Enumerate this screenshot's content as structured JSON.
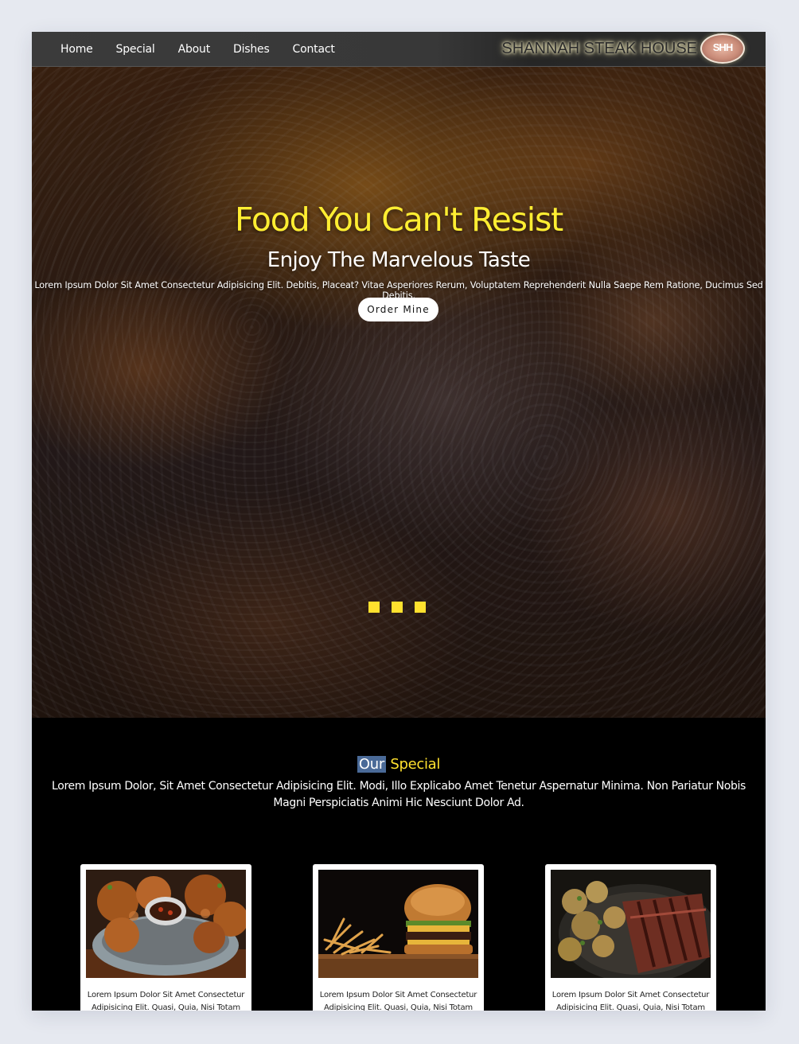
{
  "nav": {
    "links": [
      "Home",
      "Special",
      "About",
      "Dishes",
      "Contact"
    ],
    "brand": "SHANNAH STEAK HOUSE",
    "brand_logo": "SHH"
  },
  "hero": {
    "title": "Food You Can't Resist",
    "subtitle": "Enjoy The Marvelous Taste",
    "description": "Lorem Ipsum Dolor Sit Amet Consectetur Adipisicing Elit. Debitis, Placeat? Vitae Asperiores Rerum, Voluptatem Reprehenderit Nulla Saepe Rem Ratione, Ducimus Sed Debitis.",
    "button": "Order Mine",
    "slide_count": 3
  },
  "special": {
    "title_word1": "Our",
    "title_word2": "Special",
    "description": "Lorem Ipsum Dolor, Sit Amet Consectetur Adipisicing Elit. Modi, Illo Explicabo Amet Tenetur Aspernatur Minima. Non Pariatur Nobis Magni Perspiciatis Animi Hic Nesciunt Dolor Ad.",
    "cards": [
      {
        "image": "fried-chicken",
        "text": "Lorem Ipsum Dolor Sit Amet Consectetur Adipisicing Elit. Quasi, Quia, Nisi Totam Quos"
      },
      {
        "image": "burger-and-fries",
        "text": "Lorem Ipsum Dolor Sit Amet Consectetur Adipisicing Elit. Quasi, Quia, Nisi Totam Quos"
      },
      {
        "image": "steak-and-potatoes",
        "text": "Lorem Ipsum Dolor Sit Amet Consectetur Adipisicing Elit. Quasi, Quia, Nisi Totam Quos"
      }
    ]
  },
  "colors": {
    "accent_yellow": "#ffee32",
    "nav_bg": "#383838",
    "page_bg": "#e6e9f0"
  }
}
